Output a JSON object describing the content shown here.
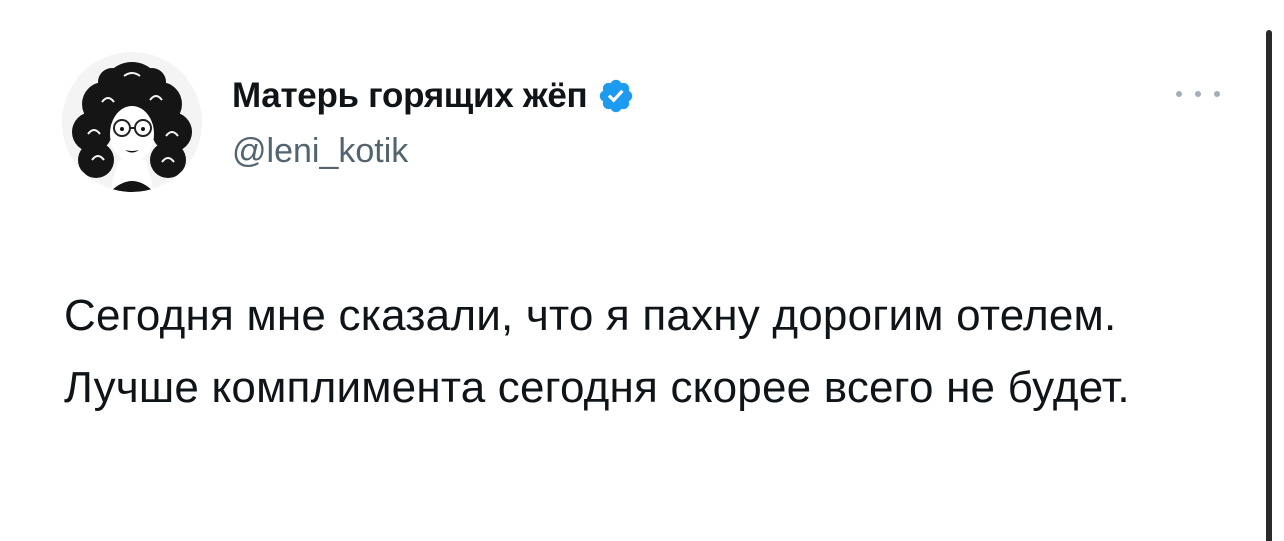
{
  "author": {
    "display_name": "Матерь горящих жёп",
    "handle": "@leni_kotik",
    "verified": true
  },
  "tweet": {
    "text": "Сегодня мне сказали, что я пахну дорогим отелем. Лучше комплимента сегодня скорее всего не будет."
  },
  "icons": {
    "verified": "verified-badge-icon",
    "more": "more-options-icon"
  },
  "colors": {
    "text_primary": "#0f1419",
    "text_secondary": "#536471",
    "verified_blue": "#1d9bf0",
    "background": "#ffffff"
  }
}
